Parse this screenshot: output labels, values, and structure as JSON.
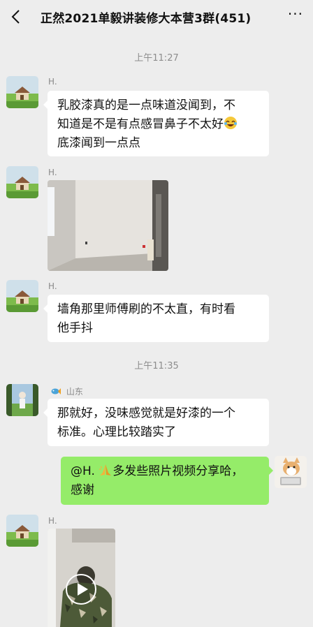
{
  "header": {
    "title": "正然2021单毅讲装修大本营3群(451)",
    "more": "···"
  },
  "messages": {
    "time1": "上午11:27",
    "m1_sender": "H.",
    "m1_line1": "乳胶漆真的是一点味道没闻到，不",
    "m1_line2": "知道是不是有点感冒鼻子不太好",
    "m1_line3": "底漆闻到一点点",
    "m2_sender": "H.",
    "m3_sender": "H.",
    "m3_line1": "墙角那里师傅刷的不太直，有时看",
    "m3_line2": "他手抖",
    "time2": "上午11:35",
    "m4_sender": "山东",
    "m4_line1": "那就好，没味感觉就是好漆的一个",
    "m4_line2": "标准。心理比较踏实了",
    "m5_mention": "@H.",
    "m5_line1_rest": "多发些照片视频分享哈，",
    "m5_line2": "感谢",
    "m6_sender": "H."
  },
  "icons": {
    "back": "chevron-left-icon",
    "more": "more-dots-icon",
    "laugh": "laughing-emoji-icon",
    "pray": "praying-hands-emoji-icon",
    "play": "play-icon",
    "badge": "fish-badge-icon"
  }
}
